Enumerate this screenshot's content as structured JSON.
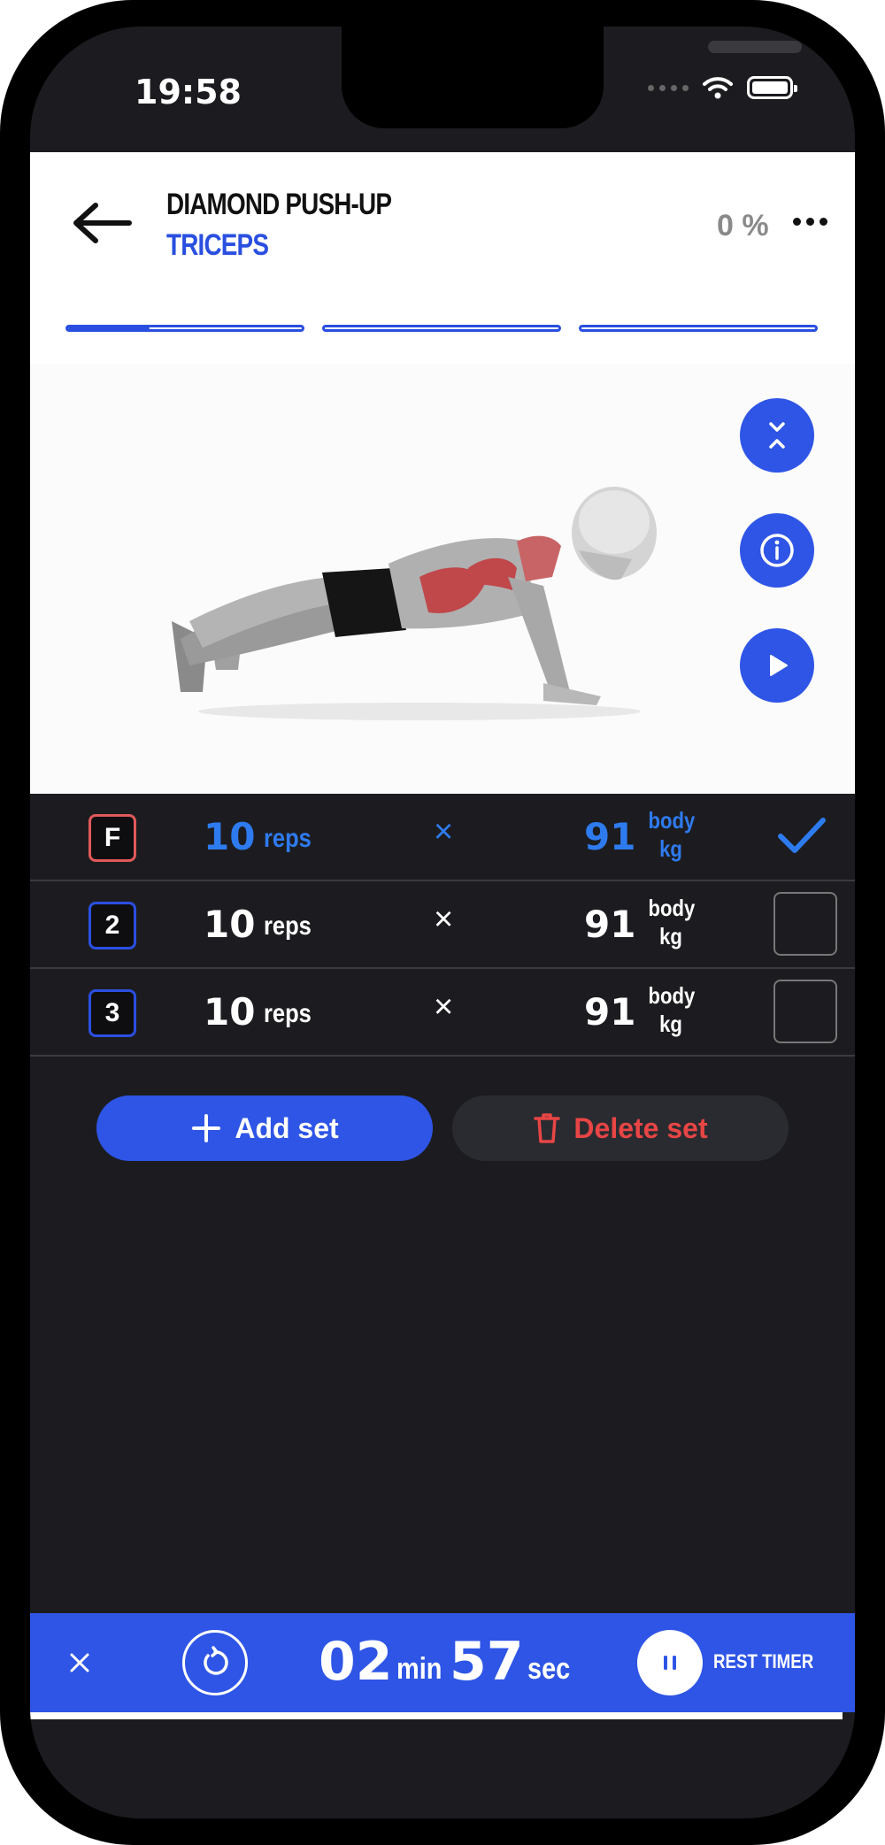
{
  "status_bar": {
    "time": "19:58"
  },
  "header": {
    "title": "DIAMOND PUSH-UP",
    "muscle": "TRICEPS",
    "percent": "0 %",
    "progress": [
      0.35,
      0,
      0
    ]
  },
  "media": {
    "icons": [
      "collapse-icon",
      "info-icon",
      "play-icon"
    ]
  },
  "sets": [
    {
      "badge": "F",
      "reps": "10",
      "reps_unit": "reps",
      "times": "×",
      "weight": "91",
      "unit_top": "body",
      "unit_bottom": "kg",
      "done": true
    },
    {
      "badge": "2",
      "reps": "10",
      "reps_unit": "reps",
      "times": "×",
      "weight": "91",
      "unit_top": "body",
      "unit_bottom": "kg",
      "done": false
    },
    {
      "badge": "3",
      "reps": "10",
      "reps_unit": "reps",
      "times": "×",
      "weight": "91",
      "unit_top": "body",
      "unit_bottom": "kg",
      "done": false
    }
  ],
  "actions": {
    "add_label": "Add set",
    "delete_label": "Delete set"
  },
  "rest_timer": {
    "minutes": "02",
    "min_unit": "min",
    "seconds": "57",
    "sec_unit": "sec",
    "label": "REST TIMER"
  },
  "colors": {
    "accent": "#2e55e6",
    "danger": "#e84545",
    "done": "#2e7bf0",
    "background": "#1c1c20"
  }
}
